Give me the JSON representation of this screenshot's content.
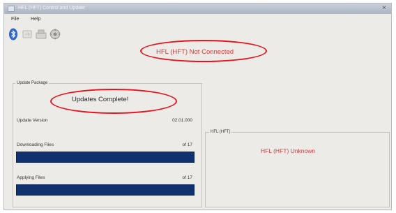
{
  "window": {
    "title": "HFL (HFT) Control and Update",
    "close_glyph": "×"
  },
  "menu": [
    {
      "label": "File"
    },
    {
      "label": "Help"
    }
  ],
  "toolbar": {
    "icons": [
      "bluetooth-icon",
      "connect-icon",
      "device-icon",
      "settings-icon"
    ]
  },
  "connection_status": "HFL (HFT) Not Connected",
  "update_package": {
    "group_label": "Update Package",
    "status": "Updates Complete!",
    "version_label": "Update Version",
    "version_value": "02.01.000",
    "downloading_label": "Downloading Files",
    "downloading_value": "of 17",
    "downloading_progress": 1.0,
    "applying_label": "Applying Files",
    "applying_value": "of 17",
    "applying_progress": 1.0
  },
  "device_panel": {
    "group_label": "HFL (HFT)",
    "status": "HFL (HFT) Unknown"
  },
  "colors": {
    "accent_red": "#d63a3a",
    "highlight_ellipse": "#e8121a",
    "progress_fill": "#11306e"
  }
}
